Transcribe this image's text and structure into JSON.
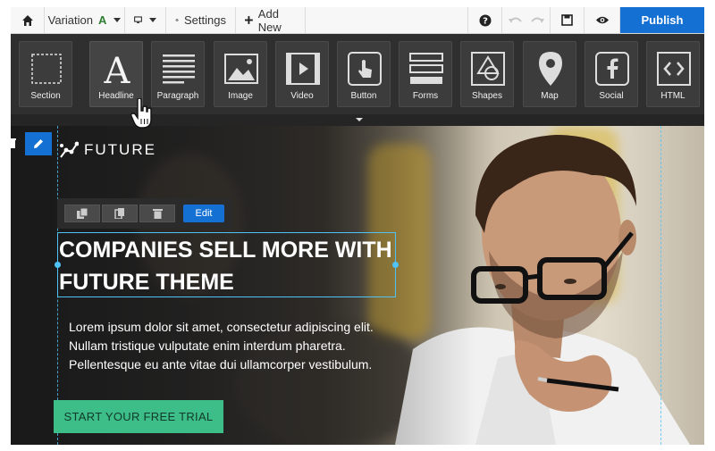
{
  "toolbar": {
    "variation_label": "Variation",
    "variation_letter": "A",
    "settings_label": "Settings",
    "add_new_label": "Add New",
    "publish_label": "Publish"
  },
  "widgets": [
    {
      "label": "Section",
      "icon": "section-icon"
    },
    {
      "label": "Headline",
      "icon": "headline-icon"
    },
    {
      "label": "Paragraph",
      "icon": "paragraph-icon"
    },
    {
      "label": "Image",
      "icon": "image-icon"
    },
    {
      "label": "Video",
      "icon": "video-icon"
    },
    {
      "label": "Button",
      "icon": "button-icon"
    },
    {
      "label": "Forms",
      "icon": "forms-icon"
    },
    {
      "label": "Shapes",
      "icon": "shapes-icon"
    },
    {
      "label": "Map",
      "icon": "map-icon"
    },
    {
      "label": "Social",
      "icon": "social-icon"
    },
    {
      "label": "HTML",
      "icon": "html-icon"
    }
  ],
  "hero": {
    "logo_text": "FUTURE",
    "edit_label": "Edit",
    "headline_line1": "COMPANIES SELL MORE WITH",
    "headline_line2": "FUTURE THEME",
    "body_line1": "Lorem ipsum dolor sit amet, consectetur adipiscing elit.",
    "body_line2": "Nullam tristique vulputate enim interdum pharetra.",
    "body_line3": "Pellentesque eu ante vitae dui ullamcorper vestibulum.",
    "cta_label": "START YOUR FREE TRIAL"
  },
  "colors": {
    "accent_blue": "#1570d3",
    "cta_green": "#3dbd88",
    "guide_cyan": "#4fc3f7",
    "palette_bg": "#2f2f2f"
  }
}
